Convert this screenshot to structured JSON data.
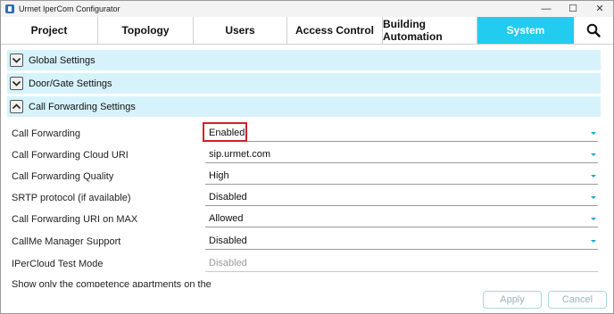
{
  "window": {
    "title": "Urmet IperCom Configurator",
    "controls": {
      "minimize": "—",
      "maximize": "☐",
      "close": "✕"
    }
  },
  "tabs": [
    {
      "label": "Project",
      "active": false
    },
    {
      "label": "Topology",
      "active": false
    },
    {
      "label": "Users",
      "active": false
    },
    {
      "label": "Access Control",
      "active": false
    },
    {
      "label": "Building Automation",
      "active": false
    },
    {
      "label": "System",
      "active": true
    }
  ],
  "search": {
    "icon": "search-icon"
  },
  "sections": [
    {
      "title": "Global Settings",
      "state": "collapsed",
      "icon": "chevron-down-icon"
    },
    {
      "title": "Door/Gate Settings",
      "state": "collapsed",
      "icon": "chevron-down-icon"
    },
    {
      "title": "Call Forwarding Settings",
      "state": "expanded",
      "icon": "chevron-up-icon"
    }
  ],
  "settings": [
    {
      "label": "Call Forwarding",
      "value": "Enabled",
      "dropdown": true,
      "highlighted": true
    },
    {
      "label": "Call Forwarding Cloud URI",
      "value": "sip.urmet.com",
      "dropdown": true
    },
    {
      "label": "Call Forwarding Quality",
      "value": "High",
      "dropdown": true
    },
    {
      "label": "SRTP protocol (if available)",
      "value": "Disabled",
      "dropdown": true
    },
    {
      "label": "Call Forwarding URI on MAX",
      "value": "Allowed",
      "dropdown": true
    },
    {
      "label": "CallMe Manager Support",
      "value": "Disabled",
      "dropdown": true
    },
    {
      "label": "IPerCloud Test Mode",
      "value": "Disabled",
      "dropdown": false,
      "disabled": true
    },
    {
      "label": "Show only the competence apartments on the"
    }
  ],
  "footer": {
    "apply": "Apply",
    "cancel": "Cancel"
  },
  "colors": {
    "accent": "#22ccee",
    "section_bg": "#d6f3fb",
    "highlight": "#d0202a"
  }
}
